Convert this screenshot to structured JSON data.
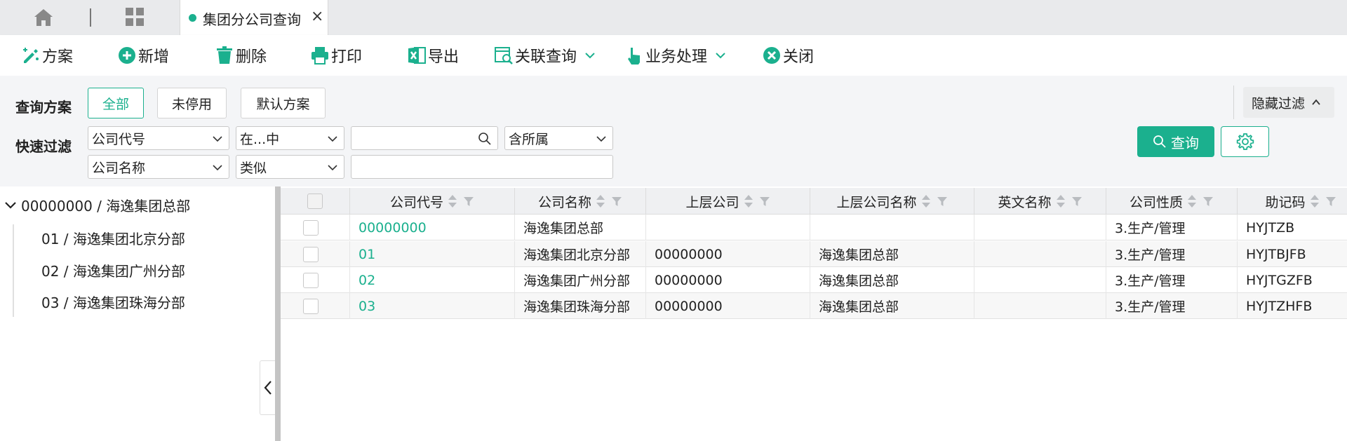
{
  "tabbar": {
    "tab": {
      "label": "集团分公司查询",
      "close": "×"
    }
  },
  "toolbar": {
    "buttons": [
      {
        "label": "方案",
        "icon": "scheme-edit-icon"
      },
      {
        "label": "新增",
        "icon": "add-circle-icon"
      },
      {
        "label": "删除",
        "icon": "trash-icon"
      },
      {
        "label": "打印",
        "icon": "printer-icon"
      },
      {
        "label": "导出",
        "icon": "excel-export-icon"
      },
      {
        "label": "关联查询",
        "icon": "related-query-icon",
        "dropdown": true
      },
      {
        "label": "业务处理",
        "icon": "hand-pointer-icon",
        "dropdown": true
      },
      {
        "label": "关闭",
        "icon": "close-circle-icon"
      }
    ]
  },
  "filter": {
    "scheme_label": "查询方案",
    "schemes": [
      "全部",
      "未停用",
      "默认方案"
    ],
    "active_scheme": "全部",
    "hide_filter": "隐藏过滤",
    "quick_label": "快速过滤",
    "row1": {
      "field": "公司代号",
      "operator": "在...中",
      "value": "",
      "scope": "含所属"
    },
    "row2": {
      "field": "公司名称",
      "operator": "类似",
      "value": ""
    },
    "query_button": "查询"
  },
  "tree": {
    "root": "00000000 / 海逸集团总部",
    "children": [
      "01 / 海逸集团北京分部",
      "02 / 海逸集团广州分部",
      "03 / 海逸集团珠海分部"
    ]
  },
  "grid": {
    "columns": [
      "公司代号",
      "公司名称",
      "上层公司",
      "上层公司名称",
      "英文名称",
      "公司性质",
      "助记码"
    ],
    "rows": [
      [
        "00000000",
        "海逸集团总部",
        "",
        "",
        "",
        "3.生产/管理",
        "HYJTZB"
      ],
      [
        "01",
        "海逸集团北京分部",
        "00000000",
        "海逸集团总部",
        "",
        "3.生产/管理",
        "HYJTBJFB"
      ],
      [
        "02",
        "海逸集团广州分部",
        "00000000",
        "海逸集团总部",
        "",
        "3.生产/管理",
        "HYJTGZFB"
      ],
      [
        "03",
        "海逸集团珠海分部",
        "00000000",
        "海逸集团总部",
        "",
        "3.生产/管理",
        "HYJTZHFB"
      ]
    ]
  },
  "colors": {
    "accent": "#1bb08e",
    "splitter": "#c4c4c4",
    "header_bg": "#eff0f2"
  }
}
